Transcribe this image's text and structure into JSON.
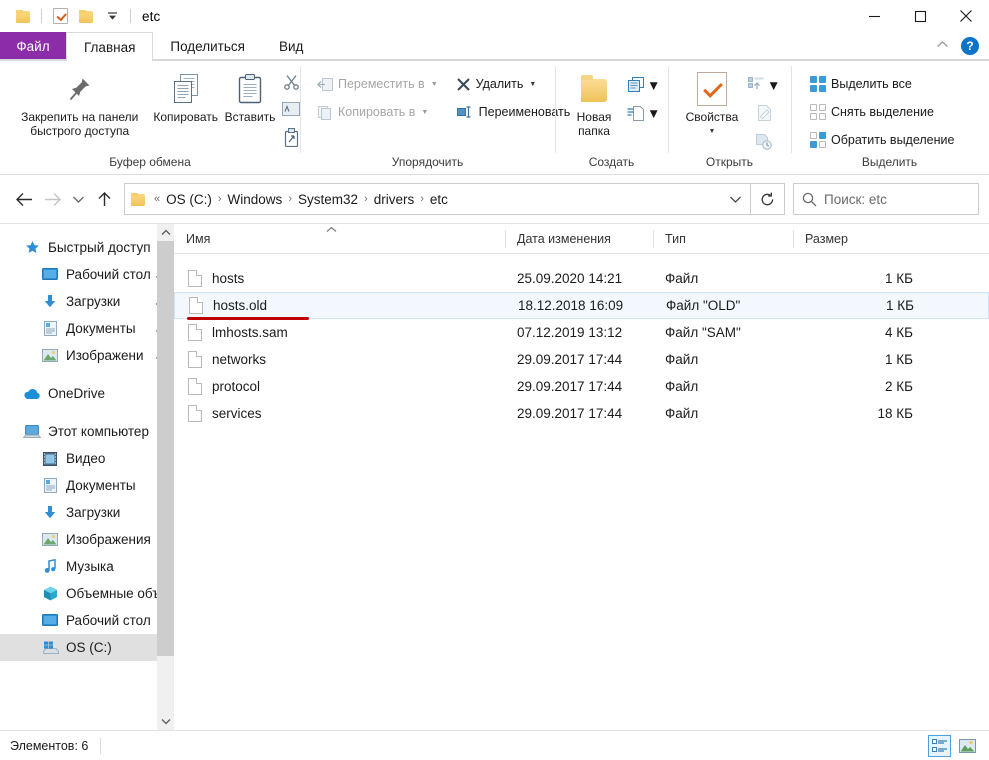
{
  "window": {
    "title": "etc",
    "quick_access": [
      "folder-icon",
      "properties-check-icon",
      "folder-icon"
    ],
    "qat_dropdown": "qat-dropdown-icon",
    "controls": {
      "minimize": "minimize-icon",
      "maximize": "maximize-icon",
      "close": "close-icon"
    }
  },
  "tabs": [
    {
      "label": "Файл",
      "kind": "file"
    },
    {
      "label": "Главная",
      "kind": "active"
    },
    {
      "label": "Поделиться",
      "kind": "normal"
    },
    {
      "label": "Вид",
      "kind": "normal"
    }
  ],
  "ribbon_right": {
    "collapse": "chevron-up-icon",
    "help": "?"
  },
  "ribbon": {
    "groups": [
      {
        "title": "Буфер обмена",
        "pin_label": "Закрепить на панели\nбыстрого доступа",
        "pin_line1": "Закрепить на панели",
        "pin_line2": "быстрого доступа",
        "copy_label": "Копировать",
        "paste_label": "Вставить",
        "small_icons": [
          "cut-icon",
          "copy-path-icon",
          "paste-shortcut-icon"
        ]
      },
      {
        "title": "Упорядочить",
        "items": [
          {
            "label": "Переместить в",
            "disabled": true,
            "caret": true,
            "icon": "move-to-icon"
          },
          {
            "label": "Копировать в",
            "disabled": true,
            "caret": true,
            "icon": "copy-to-icon"
          },
          {
            "label": "Удалить",
            "disabled": false,
            "caret": true,
            "icon": "delete-x-icon"
          },
          {
            "label": "Переименовать",
            "disabled": false,
            "caret": false,
            "icon": "rename-icon"
          }
        ]
      },
      {
        "title": "Создать",
        "new_folder_line1": "Новая",
        "new_folder_line2": "папка",
        "small_icons": [
          "new-item-icon",
          "easy-access-icon"
        ]
      },
      {
        "title": "Открыть",
        "properties_label": "Свойства",
        "small_icons": [
          "open-with-icon",
          "edit-icon",
          "history-icon"
        ]
      },
      {
        "title": "Выделить",
        "items": [
          {
            "label": "Выделить все",
            "icon": "select-all-icon"
          },
          {
            "label": "Снять выделение",
            "icon": "select-none-icon"
          },
          {
            "label": "Обратить выделение",
            "icon": "invert-selection-icon"
          }
        ]
      }
    ]
  },
  "address": {
    "back": "back-arrow-icon",
    "forward": "forward-arrow-icon",
    "recent": "recent-locations-icon",
    "up": "up-arrow-icon",
    "overflow": "«",
    "crumbs": [
      "OS (C:)",
      "Windows",
      "System32",
      "drivers",
      "etc"
    ],
    "dropdown": "chevron-down-icon",
    "refresh": "refresh-icon",
    "search_placeholder": "Поиск: etc"
  },
  "navpane": {
    "groups": [
      {
        "root": {
          "label": "Быстрый доступ",
          "icon": "star-icon"
        },
        "children": [
          {
            "label": "Рабочий стол",
            "icon": "desktop-icon",
            "pinned": true
          },
          {
            "label": "Загрузки",
            "icon": "downloads-icon",
            "pinned": true
          },
          {
            "label": "Документы",
            "icon": "documents-icon",
            "pinned": true
          },
          {
            "label": "Изображени",
            "icon": "pictures-icon",
            "pinned": true
          }
        ]
      },
      {
        "root": {
          "label": "OneDrive",
          "icon": "cloud-icon"
        },
        "children": []
      },
      {
        "root": {
          "label": "Этот компьютер",
          "icon": "this-pc-icon"
        },
        "children": [
          {
            "label": "Видео",
            "icon": "videos-icon",
            "pinned": false
          },
          {
            "label": "Документы",
            "icon": "documents-icon",
            "pinned": false
          },
          {
            "label": "Загрузки",
            "icon": "downloads-icon",
            "pinned": false
          },
          {
            "label": "Изображения",
            "icon": "pictures-icon",
            "pinned": false
          },
          {
            "label": "Музыка",
            "icon": "music-icon",
            "pinned": false
          },
          {
            "label": "Объемные объе",
            "icon": "3d-objects-icon",
            "pinned": false
          },
          {
            "label": "Рабочий стол",
            "icon": "desktop-icon",
            "pinned": false
          },
          {
            "label": "OS (C:)",
            "icon": "drive-icon",
            "pinned": false,
            "selected": true
          }
        ]
      }
    ]
  },
  "filelist": {
    "columns": [
      {
        "key": "name",
        "label": "Имя",
        "sorted": "asc"
      },
      {
        "key": "date",
        "label": "Дата изменения"
      },
      {
        "key": "type",
        "label": "Тип"
      },
      {
        "key": "size",
        "label": "Размер"
      }
    ],
    "rows": [
      {
        "name": "hosts",
        "date": "25.09.2020 14:21",
        "type": "Файл",
        "size": "1 КБ",
        "selected": false,
        "underlined": false
      },
      {
        "name": "hosts.old",
        "date": "18.12.2018 16:09",
        "type": "Файл \"OLD\"",
        "size": "1 КБ",
        "selected": true,
        "underlined": true
      },
      {
        "name": "lmhosts.sam",
        "date": "07.12.2019 13:12",
        "type": "Файл \"SAM\"",
        "size": "4 КБ",
        "selected": false,
        "underlined": false
      },
      {
        "name": "networks",
        "date": "29.09.2017 17:44",
        "type": "Файл",
        "size": "1 КБ",
        "selected": false,
        "underlined": false
      },
      {
        "name": "protocol",
        "date": "29.09.2017 17:44",
        "type": "Файл",
        "size": "2 КБ",
        "selected": false,
        "underlined": false
      },
      {
        "name": "services",
        "date": "29.09.2017 17:44",
        "type": "Файл",
        "size": "18 КБ",
        "selected": false,
        "underlined": false
      }
    ]
  },
  "statusbar": {
    "count_text": "Элементов: 6",
    "views": [
      {
        "name": "details-view-icon",
        "active": true
      },
      {
        "name": "large-icons-view-icon",
        "active": false
      }
    ]
  },
  "colors": {
    "file_tab": "#8c2ca8",
    "accent_blue": "#0a74c8",
    "selection_bg": "#f2f8fd",
    "selection_border": "#cfe4f7",
    "underline_red": "#c00000",
    "nav_selected": "#e0e0e0"
  }
}
